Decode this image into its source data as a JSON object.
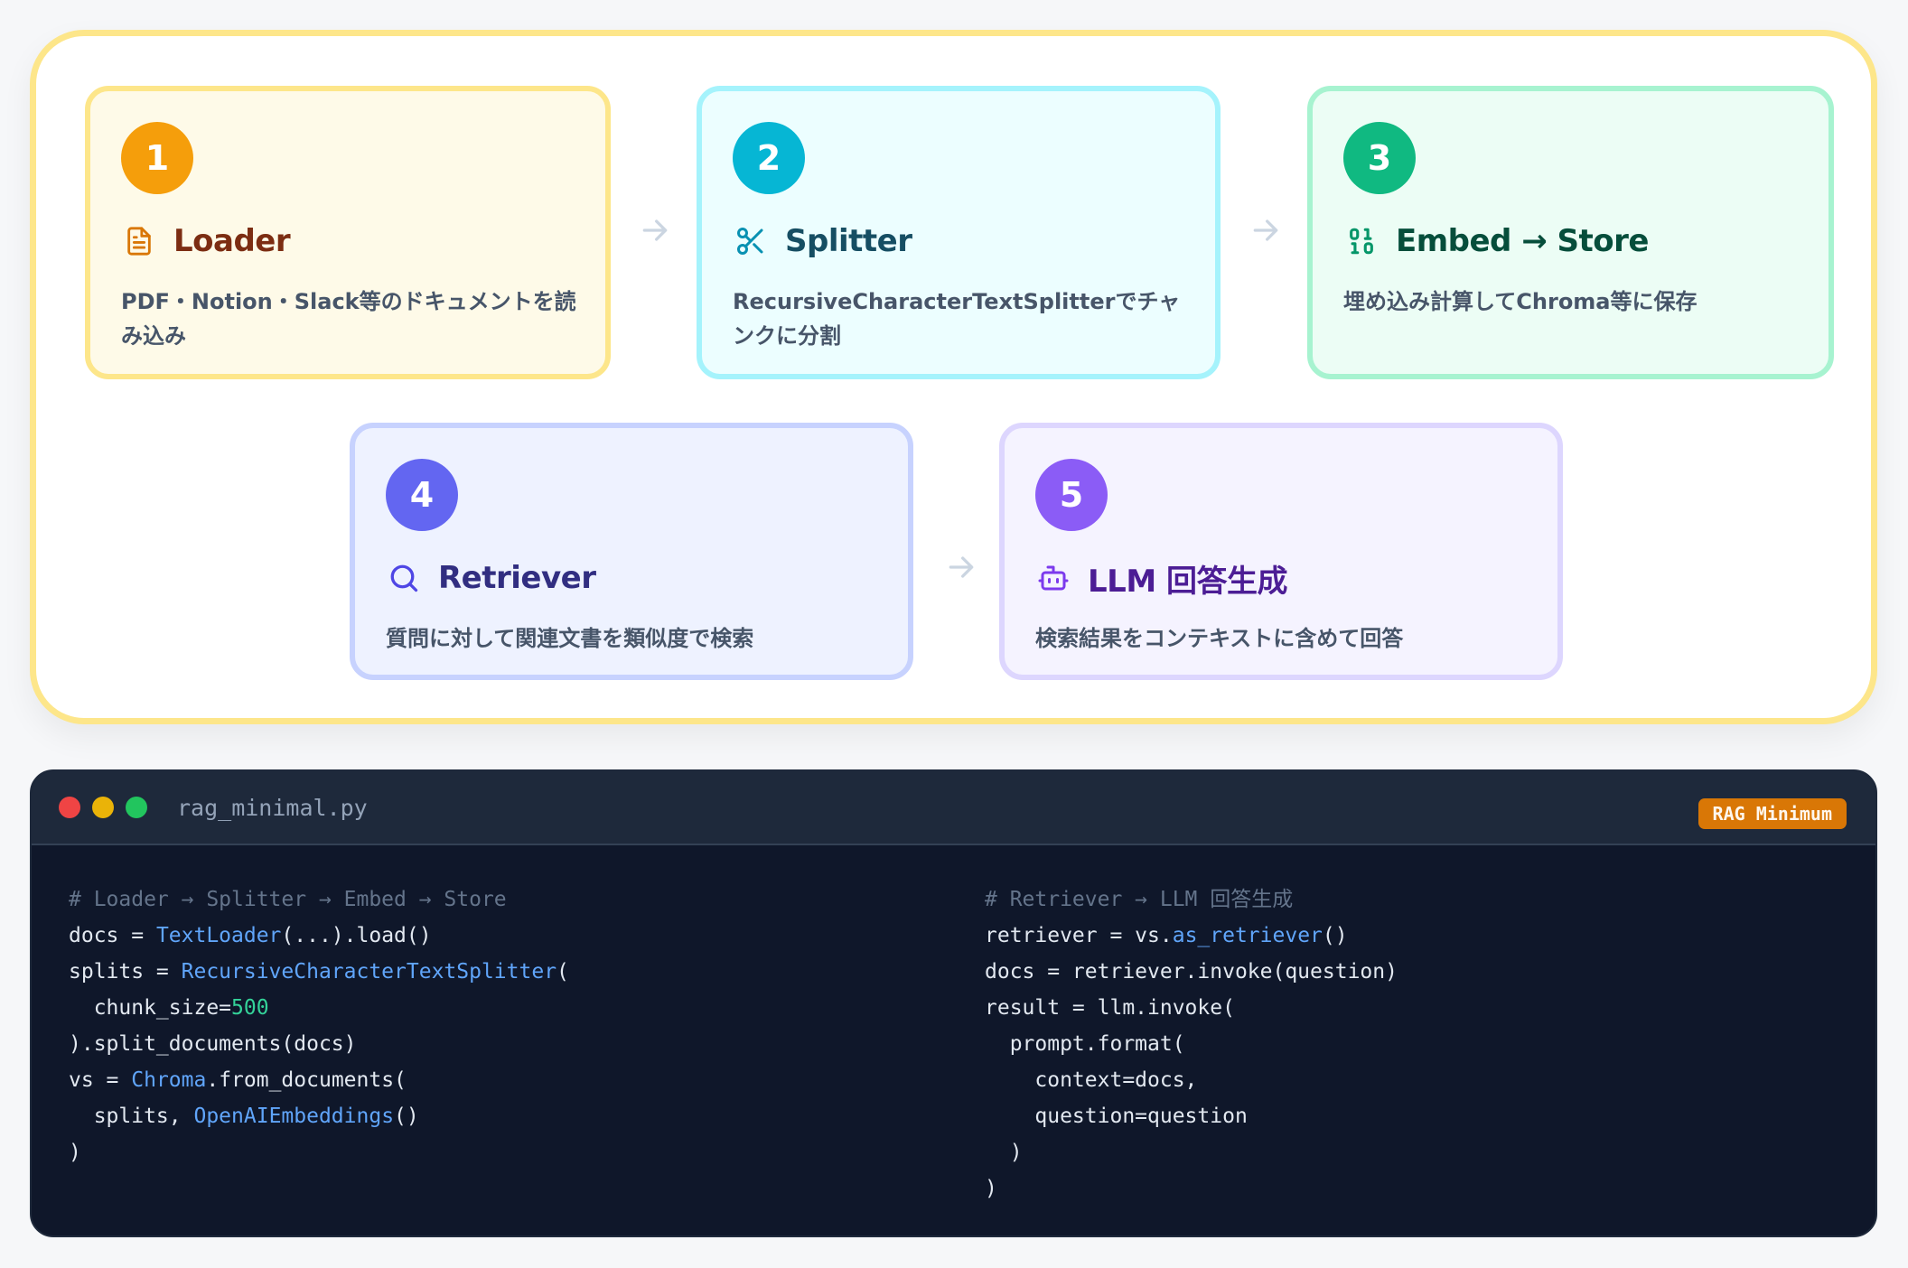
{
  "steps": [
    {
      "number": "1",
      "title": "Loader",
      "desc": "PDF・Notion・Slack等のドキュメントを読み込み",
      "icon": "document-icon",
      "color": "#f59e0b"
    },
    {
      "number": "2",
      "title": "Splitter",
      "desc": "RecursiveCharacterTextSplitterでチャンクに分割",
      "icon": "scissors-icon",
      "color": "#06b6d4"
    },
    {
      "number": "3",
      "title": "Embed → Store",
      "desc": "埋め込み計算してChroma等に保存",
      "icon": "binary-icon",
      "color": "#10b981"
    },
    {
      "number": "4",
      "title": "Retriever",
      "desc": "質問に対して関連文書を類似度で検索",
      "icon": "search-icon",
      "color": "#6366f1"
    },
    {
      "number": "5",
      "title": "LLM 回答生成",
      "desc": "検索結果をコンテキストに含めて回答",
      "icon": "robot-icon",
      "color": "#8b5cf6"
    }
  ],
  "code_window": {
    "filename": "rag_minimal.py",
    "tag": "RAG Minimum",
    "left_lines": [
      [
        {
          "t": "# Loader → Splitter → Embed → Store",
          "c": "cm"
        }
      ],
      [
        {
          "t": "docs = "
        },
        {
          "t": "TextLoader",
          "c": "fn"
        },
        {
          "t": "(...).load()"
        }
      ],
      [
        {
          "t": "splits = "
        },
        {
          "t": "RecursiveCharacterTextSplitter",
          "c": "fn"
        },
        {
          "t": "("
        }
      ],
      [
        {
          "t": "  chunk_size="
        },
        {
          "t": "500",
          "c": "num"
        }
      ],
      [
        {
          "t": ").split_documents(docs)"
        }
      ],
      [
        {
          "t": "vs = "
        },
        {
          "t": "Chroma",
          "c": "fn"
        },
        {
          "t": ".from_documents("
        }
      ],
      [
        {
          "t": "  splits, "
        },
        {
          "t": "OpenAIEmbeddings",
          "c": "fn"
        },
        {
          "t": "()"
        }
      ],
      [
        {
          "t": ")"
        }
      ]
    ],
    "right_lines": [
      [
        {
          "t": "# Retriever → LLM 回答生成",
          "c": "cm"
        }
      ],
      [
        {
          "t": "retriever = vs."
        },
        {
          "t": "as_retriever",
          "c": "fn"
        },
        {
          "t": "()"
        }
      ],
      [
        {
          "t": "docs = retriever.invoke(question)"
        }
      ],
      [
        {
          "t": "result = llm.invoke("
        }
      ],
      [
        {
          "t": "  prompt.format("
        }
      ],
      [
        {
          "t": "    context=docs,"
        }
      ],
      [
        {
          "t": "    question=question"
        }
      ],
      [
        {
          "t": "  )"
        }
      ],
      [
        {
          "t": ")"
        }
      ]
    ]
  }
}
